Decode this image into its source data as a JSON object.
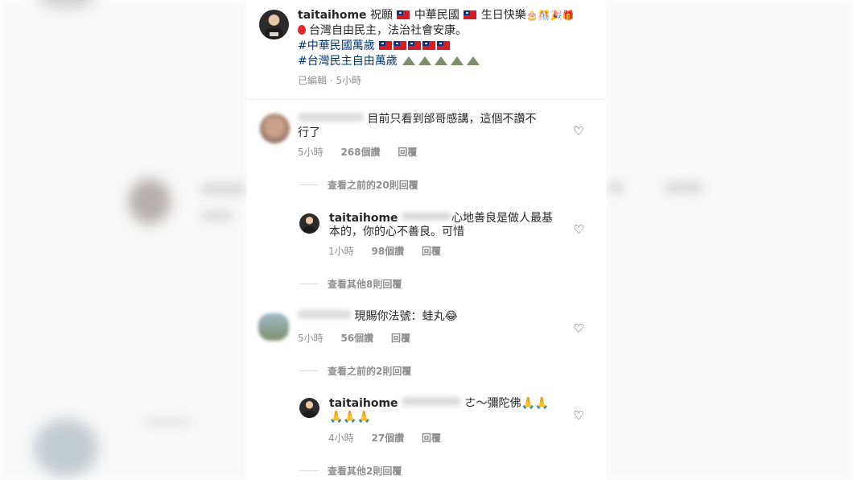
{
  "post": {
    "username": "taitaihome",
    "caption_line1": "祝願",
    "caption_line1b": "中華民國",
    "caption_line1c": "生日快樂",
    "caption_line2": "台灣自由民主，法治社會安康。",
    "hashtag1": "#中華民國萬歲",
    "hashtag2": "#台灣民主自由萬歲",
    "edited": "已編輯 · 5小時"
  },
  "comments": [
    {
      "text_line1": "目前只看到邰哥感講，這個不讚不",
      "text_line2": "行了",
      "time": "5小時",
      "likes": "268個讚",
      "reply": "回覆"
    },
    {
      "view_replies": "查看之前的20則回覆"
    },
    {
      "username": "taitaihome",
      "text_line1": "心地善良是做人最基",
      "text_line2": "本的，你的心不善良。可惜",
      "time": "1小時",
      "likes": "98個讚",
      "reply": "回覆"
    },
    {
      "view_replies": "查看其他8則回覆"
    },
    {
      "text_line1": "現賜你法號：蛙丸",
      "time": "5小時",
      "likes": "56個讚",
      "reply": "回覆"
    },
    {
      "view_replies": "查看之前的2則回覆"
    },
    {
      "username": "taitaihome",
      "text_line1": "ㄜ～彌陀佛",
      "time": "4小時",
      "likes": "27個讚",
      "reply": "回覆"
    },
    {
      "view_replies": "查看其他2則回覆"
    }
  ],
  "icons": {
    "heart": "heart-outline-icon",
    "flag": "roc-flag-emoji",
    "balloon": "balloon-emoji",
    "mountain": "mountain-emoji",
    "pray": "folded-hands-emoji"
  }
}
